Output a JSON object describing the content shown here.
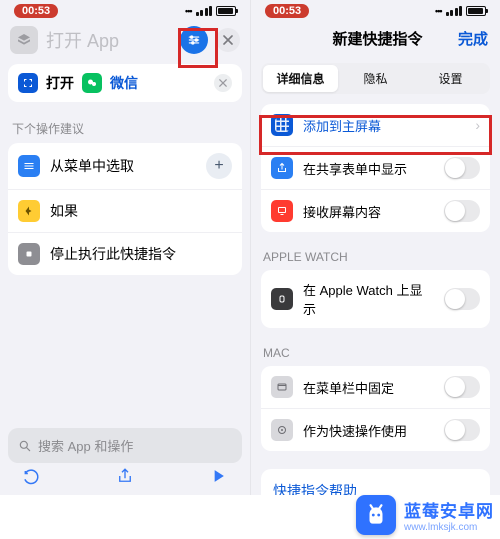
{
  "status": {
    "time": "00:53"
  },
  "left": {
    "title": "打开 App",
    "action": {
      "verb": "打开",
      "app": "微信"
    },
    "suggestions_header": "下个操作建议",
    "suggestions": [
      {
        "icon": "menu-icon",
        "label": "从菜单中选取"
      },
      {
        "icon": "if-icon",
        "label": "如果"
      },
      {
        "icon": "stop-icon",
        "label": "停止执行此快捷指令"
      }
    ],
    "search_placeholder": "搜索 App 和操作"
  },
  "right": {
    "title": "新建快捷指令",
    "done": "完成",
    "tabs": [
      "详细信息",
      "隐私",
      "设置"
    ],
    "sec1": [
      {
        "icon": "add-home-icon",
        "label": "添加到主屏幕",
        "accent": true,
        "control": "chevron"
      },
      {
        "icon": "share-icon",
        "label": "在共享表单中显示",
        "control": "toggle"
      },
      {
        "icon": "receive-icon",
        "label": "接收屏幕内容",
        "control": "toggle"
      }
    ],
    "sec2_header": "APPLE WATCH",
    "sec2": [
      {
        "icon": "watch-icon",
        "label": "在 Apple Watch 上显示",
        "control": "toggle"
      }
    ],
    "sec3_header": "MAC",
    "sec3": [
      {
        "icon": "menubar-icon",
        "label": "在菜单栏中固定",
        "control": "toggle"
      },
      {
        "icon": "quick-icon",
        "label": "作为快速操作使用",
        "control": "toggle"
      }
    ],
    "help": "快捷指令帮助"
  },
  "watermark": {
    "name": "蓝莓安卓网",
    "url": "www.lmksjk.com"
  }
}
